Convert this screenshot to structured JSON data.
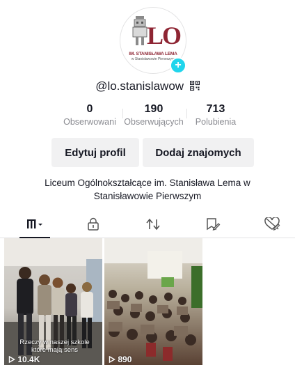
{
  "profile": {
    "logo_line1": "IM. STANISŁAWA LEMA",
    "logo_line2": "w Stanisławowie Pierwszym",
    "username": "@lo.stanislawow",
    "bio": "Liceum Ogólnokształcące im. Stanisława Lema w Stanisławowie Pierwszym"
  },
  "stats": [
    {
      "value": "0",
      "label": "Obserwowani"
    },
    {
      "value": "190",
      "label": "Obserwujących"
    },
    {
      "value": "713",
      "label": "Polubienia"
    }
  ],
  "buttons": {
    "edit": "Edytuj profil",
    "add_friends": "Dodaj znajomych"
  },
  "tabs": [
    "videos-grid-icon",
    "lock-icon",
    "repost-icon",
    "bookmark-icon",
    "liked-icon"
  ],
  "videos": [
    {
      "views": "10.4K",
      "caption": "Rzeczy w naszej szkole które mają sens"
    },
    {
      "views": "890"
    }
  ],
  "colors": {
    "accent": "#20d5ec",
    "brand": "#8e2533",
    "secondary_text": "#8a8b91"
  }
}
